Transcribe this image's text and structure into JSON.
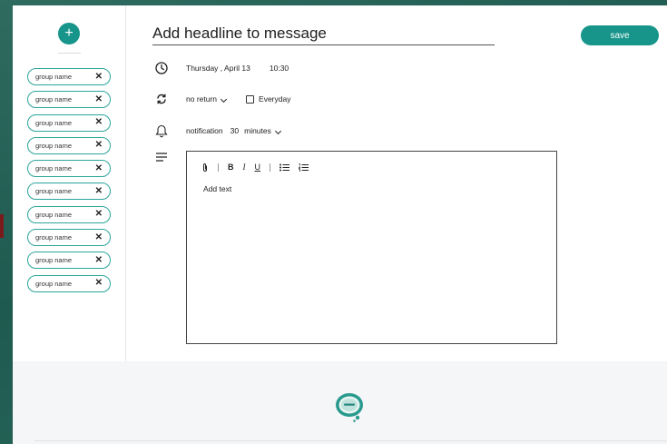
{
  "sidebar": {
    "add_label": "+",
    "groups": [
      {
        "label": "group name"
      },
      {
        "label": "group name"
      },
      {
        "label": "group name"
      },
      {
        "label": "group name"
      },
      {
        "label": "group name"
      },
      {
        "label": "group name"
      },
      {
        "label": "group name"
      },
      {
        "label": "group name"
      },
      {
        "label": "group name"
      },
      {
        "label": "group name"
      }
    ],
    "remove_glyph": "✕"
  },
  "header": {
    "headline": "Add headline to message",
    "save_label": "save"
  },
  "schedule": {
    "date": "Thursday , April 13",
    "time": "10:30"
  },
  "repeat": {
    "value": "no return",
    "everyday_label": "Everyday",
    "everyday_checked": false
  },
  "notification": {
    "label": "notification",
    "amount": "30",
    "unit": "minutes"
  },
  "editor": {
    "placeholder": "Add text",
    "toolbar": {
      "bold": "B",
      "italic": "I",
      "underline": "U"
    }
  },
  "colors": {
    "accent": "#17958b",
    "background": "#2f6b5f",
    "footer": "#f5f6f8"
  },
  "icons": [
    "plus-icon",
    "close-icon",
    "clock-icon",
    "repeat-icon",
    "bell-icon",
    "lines-icon",
    "paperclip-icon",
    "bullet-list-icon",
    "numbered-list-icon",
    "speech-bubble-logo"
  ]
}
